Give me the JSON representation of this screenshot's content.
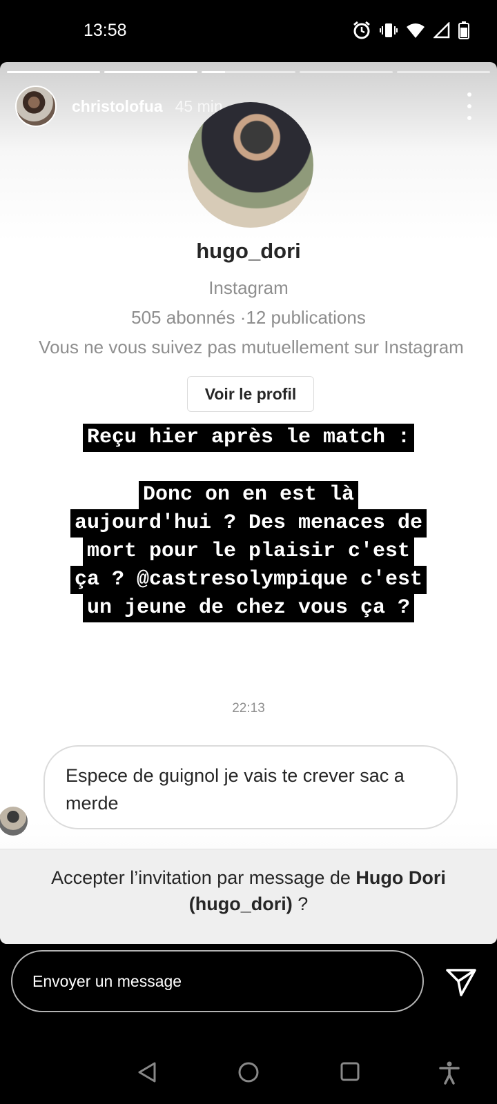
{
  "status_bar": {
    "time": "13:58"
  },
  "story": {
    "username": "christolofua",
    "time_ago": "45 min.",
    "progress": [
      1,
      1,
      0.25,
      0,
      0
    ]
  },
  "profile_card": {
    "username": "hugo_dori",
    "platform": "Instagram",
    "stats": "505 abonnés ·12 publications",
    "mutual_text": "Vous ne vous suivez pas mutuellement sur Instagram",
    "view_profile_label": "Voir le profil"
  },
  "overlay_text": {
    "line1": "Reçu hier après le match :",
    "lines": [
      "Donc on en est là",
      "aujourd'hui ? Des menaces de",
      "mort pour le plaisir c'est",
      "ça ? @castresolympique c'est",
      "un jeune de chez vous ça ?"
    ]
  },
  "message": {
    "time": "22:13",
    "text": "Espece de guignol je vais te crever sac a merde"
  },
  "accept": {
    "prefix": "Accepter l’invitation par message de ",
    "name": "Hugo Dori",
    "handle": "(hugo_dori)",
    "suffix": " ?"
  },
  "reply": {
    "placeholder": "Envoyer un message"
  },
  "icons": [
    "alarm-icon",
    "vibrate-icon",
    "wifi-icon",
    "signal-icon",
    "battery-icon",
    "more-icon",
    "send-icon",
    "nav-back-icon",
    "nav-home-icon",
    "nav-recents-icon",
    "accessibility-icon"
  ]
}
